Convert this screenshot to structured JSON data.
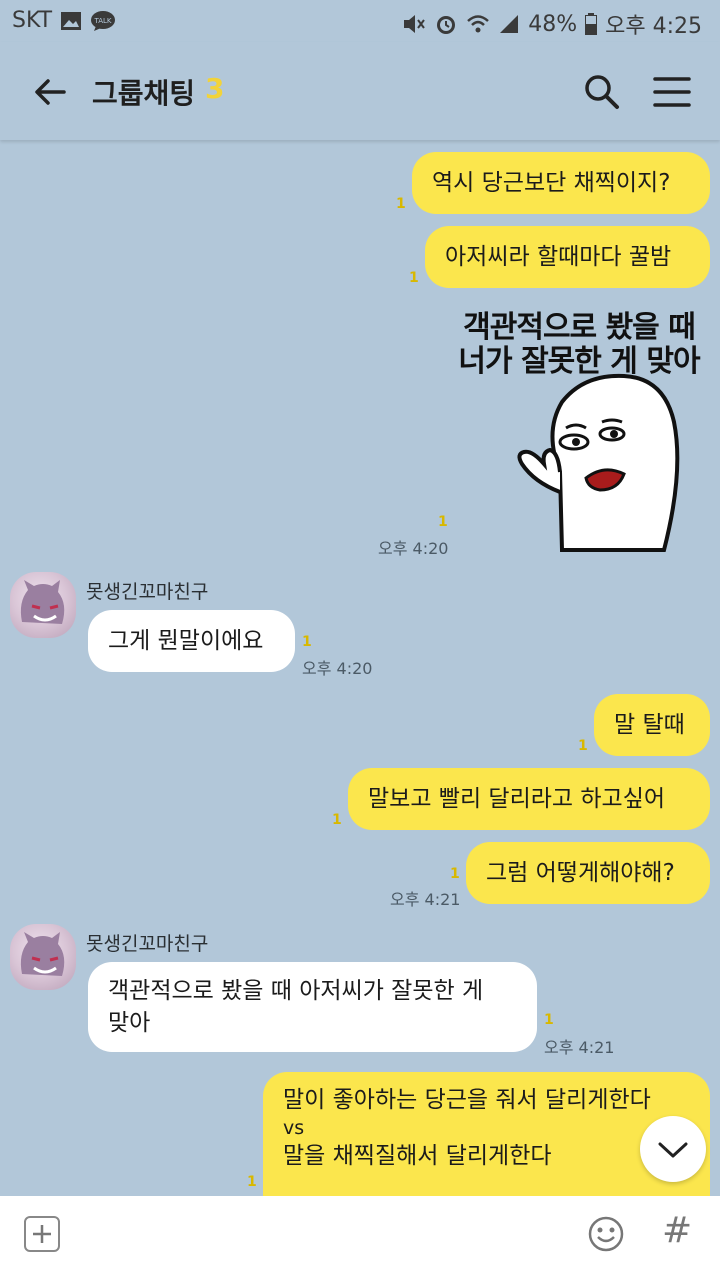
{
  "statusbar": {
    "carrier": "SKT",
    "battery": "48%",
    "time": "오후 4:25"
  },
  "header": {
    "title": "그룹채팅",
    "member_count": "3"
  },
  "messages": {
    "m1": {
      "text": "역시 당근보단 채찍이지?",
      "unread": "1"
    },
    "m2": {
      "text": "아저씨라 할때마다 꿀밤",
      "unread": "1"
    },
    "sticker": {
      "line1": "객관적으로 봤을 때",
      "line2": "너가 잘못한 게 맞아",
      "unread": "1",
      "time": "오후 4:20"
    },
    "m3": {
      "sender": "못생긴꼬마친구",
      "text": "그게 뭔말이에요",
      "unread": "1",
      "time": "오후 4:20"
    },
    "m4": {
      "text": "말 탈때",
      "unread": "1"
    },
    "m5": {
      "text": "말보고 빨리 달리라고 하고싶어",
      "unread": "1"
    },
    "m6": {
      "text": "그럼 어떻게해야해?",
      "unread": "1",
      "time": "오후 4:21"
    },
    "m7": {
      "sender": "못생긴꼬마친구",
      "line1": "객관적으로 봤을 때 아저씨가 잘못한 게",
      "line2": "맞아",
      "unread": "1",
      "time": "오후 4:21"
    },
    "m8": {
      "line1": "말이 좋아하는 당근을 줘서 달리게한다",
      "line2": "vs",
      "line3": "말을 채찍질해서 달리게한다",
      "unread": "1"
    }
  },
  "inputbar": {
    "hash": "#"
  },
  "colors": {
    "background": "#b2c7d9",
    "my_bubble": "#fbe64d",
    "their_bubble": "#ffffff",
    "accent_count": "#f2d33a"
  }
}
